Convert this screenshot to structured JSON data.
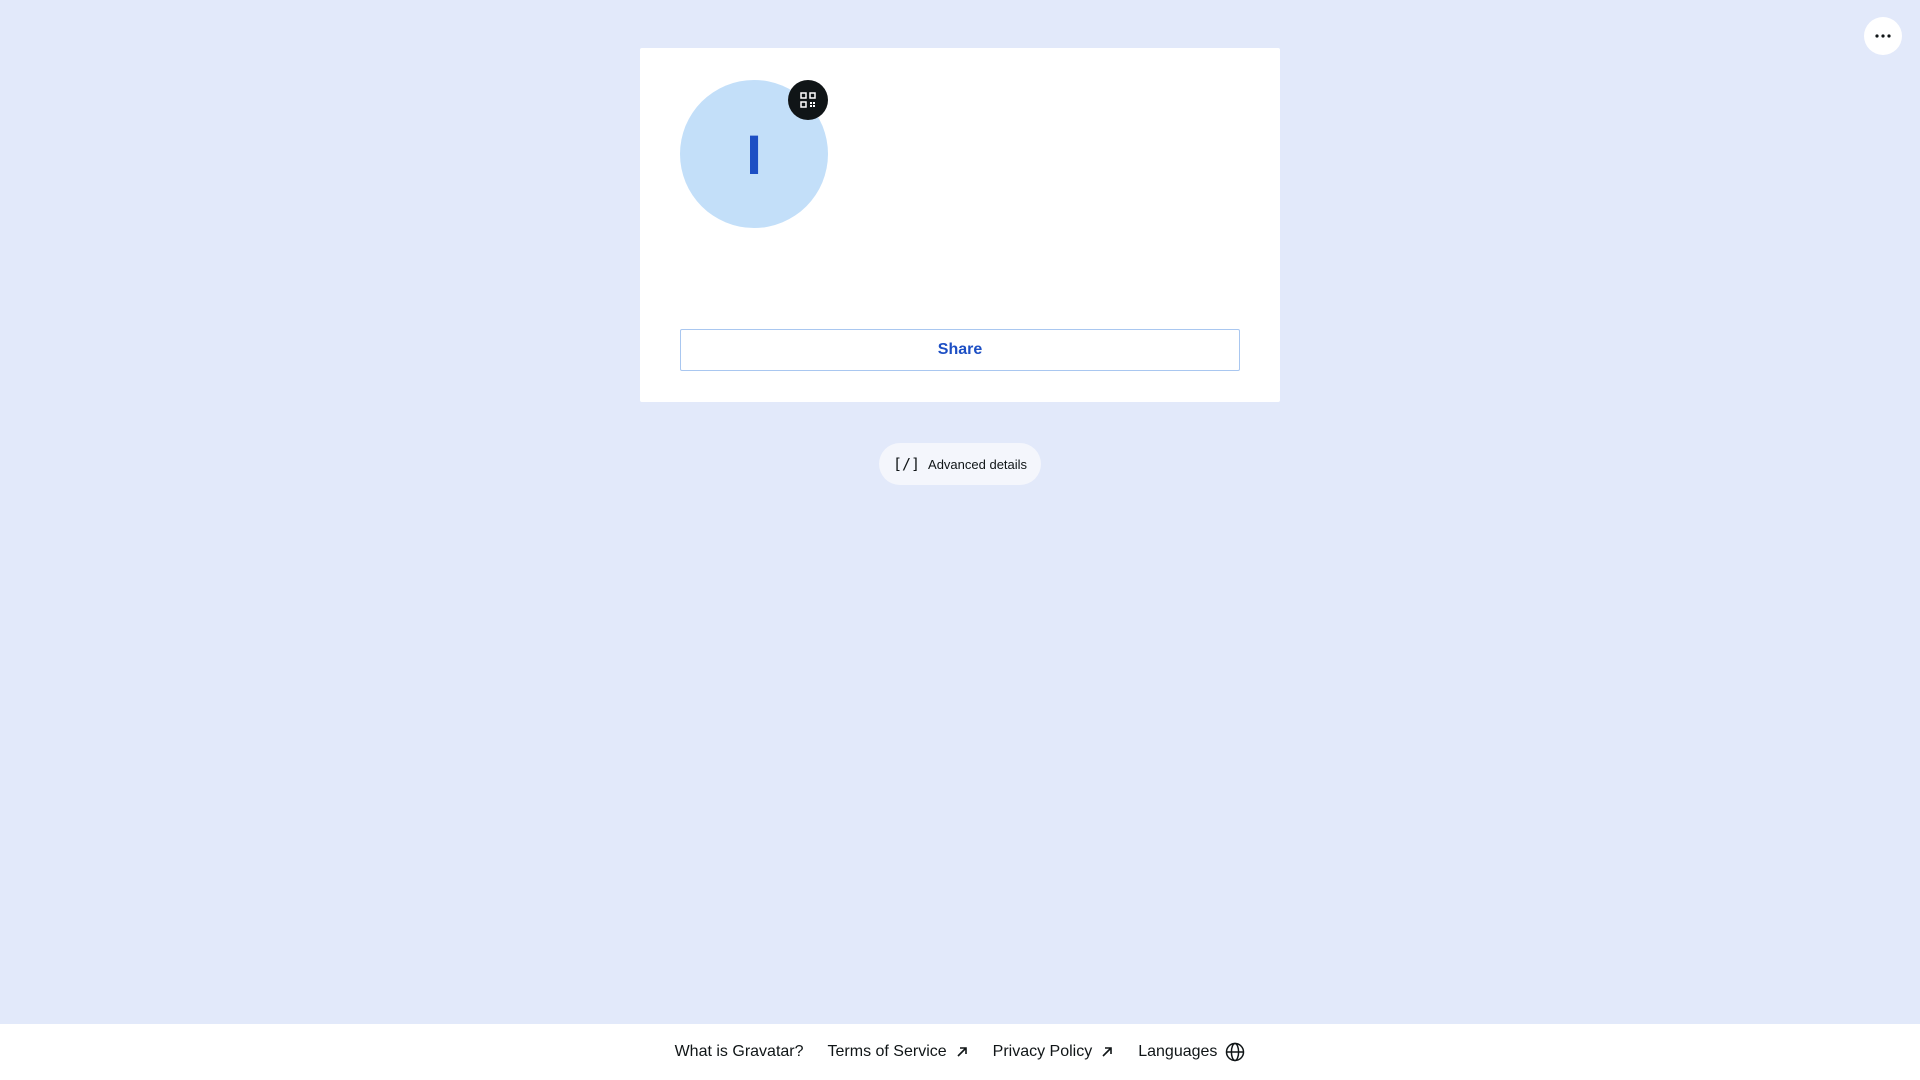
{
  "header": {
    "more_icon": "ellipsis-icon"
  },
  "profile": {
    "avatar_initial": "I",
    "avatar_bg": "#c3dff9",
    "avatar_fg": "#1d4fc4",
    "qr_icon": "qr-code-icon",
    "share_label": "Share"
  },
  "advanced": {
    "icon_text": "[/]",
    "label": "Advanced details"
  },
  "footer": {
    "links": [
      {
        "label": "What is Gravatar?"
      },
      {
        "label": "Terms of Service",
        "icon": "external-arrow-icon"
      },
      {
        "label": "Privacy Policy",
        "icon": "external-arrow-icon"
      },
      {
        "label": "Languages",
        "icon": "globe-icon"
      }
    ]
  },
  "colors": {
    "page_bg": "#e2e9fa",
    "accent": "#1d4fc4"
  }
}
